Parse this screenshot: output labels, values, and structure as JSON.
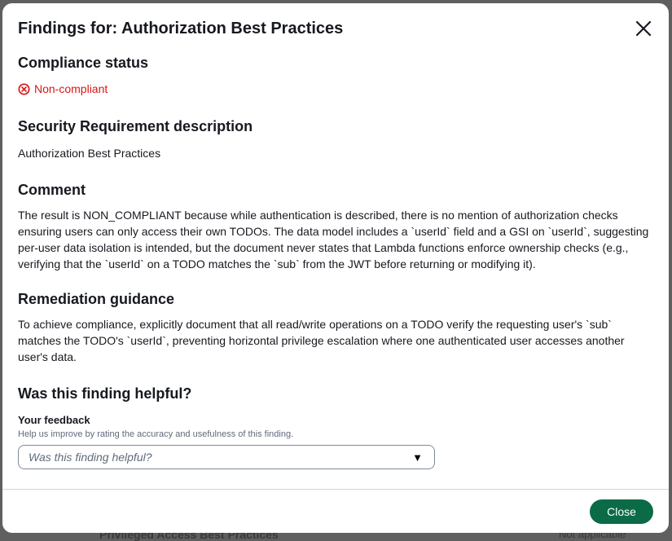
{
  "modal": {
    "title": "Findings for: Authorization Best Practices"
  },
  "compliance": {
    "heading": "Compliance status",
    "status": "Non-compliant",
    "status_icon": "x-circle-icon",
    "status_color": "#d91515"
  },
  "requirement": {
    "heading": "Security Requirement description",
    "text": "Authorization Best Practices"
  },
  "comment": {
    "heading": "Comment",
    "text": "The result is NON_COMPLIANT because while authentication is described, there is no mention of authorization checks ensuring users can only access their own TODOs. The data model includes a `userId` field and a GSI on `userId`, suggesting per-user data isolation is intended, but the document never states that Lambda functions enforce ownership checks (e.g., verifying that the `userId` on a TODO matches the `sub` from the JWT before returning or modifying it)."
  },
  "remediation": {
    "heading": "Remediation guidance",
    "text": "To achieve compliance, explicitly document that all read/write operations on a TODO verify the requesting user's `sub` matches the TODO's `userId`, preventing horizontal privilege escalation where one authenticated user accesses another user's data."
  },
  "feedback": {
    "heading": "Was this finding helpful?",
    "label": "Your feedback",
    "help": "Help us improve by rating the accuracy and usefulness of this finding.",
    "placeholder": "Was this finding helpful?"
  },
  "footer": {
    "close_label": "Close",
    "button_color": "#0a6b46"
  },
  "backdrop": {
    "partial_row_text": "Privileged Access Best Practices",
    "partial_status_text": "Not applicable"
  }
}
